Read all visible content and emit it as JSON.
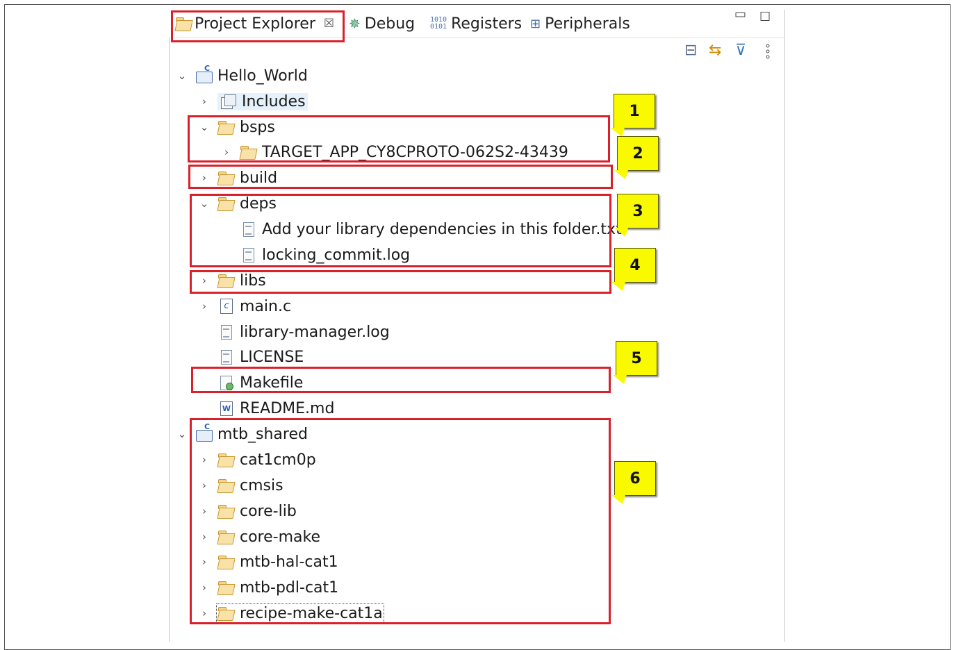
{
  "tabs": [
    {
      "label": "Project Explorer",
      "close": "☒",
      "icon": "project-explorer-icon"
    },
    {
      "label": "Debug",
      "icon": "debug-bug-icon"
    },
    {
      "label": "Registers",
      "icon": "registers-icon"
    },
    {
      "label": "Peripherals",
      "icon": "peripherals-icon"
    }
  ],
  "window_controls": {
    "minimize": "▭",
    "maximize": "☐"
  },
  "toolbar_icons": [
    "collapse-all-icon",
    "link-editor-icon",
    "filter-icon",
    "view-menu-icon"
  ],
  "tree": {
    "hello_world": {
      "label": "Hello_World",
      "expanded": true
    },
    "includes": "Includes",
    "bsps": "bsps",
    "target_app": "TARGET_APP_CY8CPROTO-062S2-43439",
    "build": "build",
    "deps": "deps",
    "deps_readme": "Add your library dependencies in this folder.txt",
    "locking_commit": "locking_commit.log",
    "libs": "libs",
    "main_c": "main.c",
    "library_manager_log": "library-manager.log",
    "license": "LICENSE",
    "makefile": "Makefile",
    "readme": "README.md",
    "mtb_shared": "mtb_shared",
    "cat1cm0p": "cat1cm0p",
    "cmsis": "cmsis",
    "core_lib": "core-lib",
    "core_make": "core-make",
    "mtb_hal_cat1": "mtb-hal-cat1",
    "mtb_pdl_cat1": "mtb-pdl-cat1",
    "recipe_make_cat1a": "recipe-make-cat1a"
  },
  "callouts": [
    "1",
    "2",
    "3",
    "4",
    "5",
    "6"
  ],
  "colors": {
    "highlight_red": "#d9202b",
    "callout_yellow": "#f9f900",
    "selection_blue": "#e5f1fb"
  }
}
